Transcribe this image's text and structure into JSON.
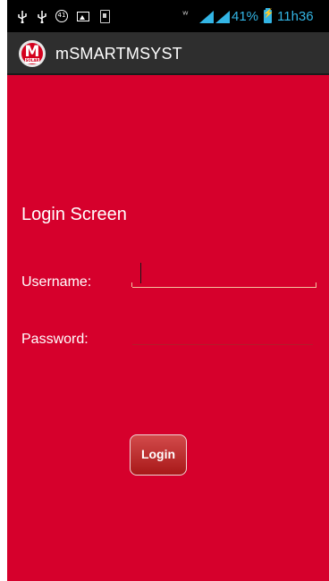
{
  "status_bar": {
    "notification_badge": "41",
    "battery_percent": "41%",
    "time": "11h36",
    "icons": [
      "usb-icon",
      "usb-icon",
      "badge-icon",
      "gallery-icon",
      "sim-icon",
      "bluetooth-icon",
      "signal-icon",
      "signal-icon",
      "battery-icon"
    ],
    "accent_color": "#33b5e5"
  },
  "action_bar": {
    "app_title": "mSMARTMSYST",
    "logo_letter": "M",
    "logo_subtext": "SOLAR"
  },
  "screen": {
    "title": "Login Screen",
    "background_color": "#d6002c"
  },
  "form": {
    "username_label": "Username:",
    "username_value": "",
    "password_label": "Password:",
    "password_value": "",
    "login_label": "Login"
  }
}
